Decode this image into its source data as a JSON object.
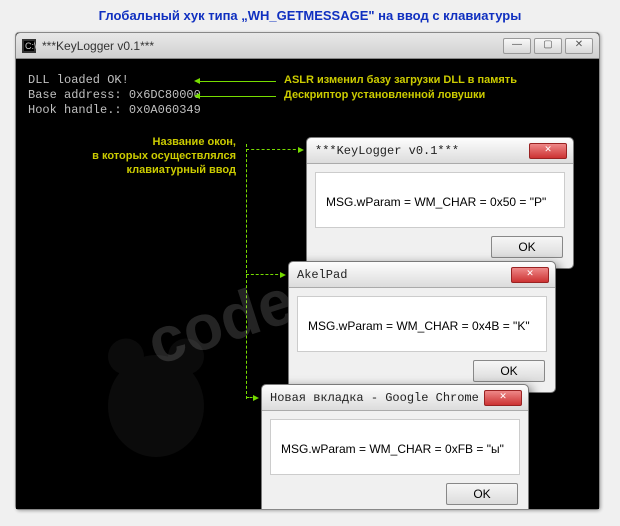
{
  "title": "Глобальный хук типа „WH_GETMESSAGE\" на ввод с клавиатуры",
  "console": {
    "title": "***KeyLogger v0.1***",
    "lines": [
      "DLL loaded OK!",
      "Base address: 0x6DC80000",
      "Hook handle.: 0x0A060349"
    ]
  },
  "annotations": {
    "aslr": "ASLR изменил базу загрузки DLL в память",
    "hook": "Дескриптор установленной ловушки",
    "winname1": "Название окон,",
    "winname2": "в которых осуществлялся",
    "winname3": "клавиатурный ввод"
  },
  "dialogs": [
    {
      "title": "***KeyLogger v0.1***",
      "msg": "MSG.wParam = WM_CHAR = 0x50 = \"P\"",
      "ok": "OK"
    },
    {
      "title": "AkelPad",
      "msg": "MSG.wParam = WM_CHAR = 0x4B = \"K\"",
      "ok": "OK"
    },
    {
      "title": "Новая вкладка - Google Chrome",
      "msg": "MSG.wParam = WM_CHAR = 0xFB = \"ы\"",
      "ok": "OK"
    }
  ],
  "buttons": {
    "min": "—",
    "max": "▢",
    "close": "✕",
    "dlgclose": "✕"
  },
  "watermark": "codeby.net"
}
